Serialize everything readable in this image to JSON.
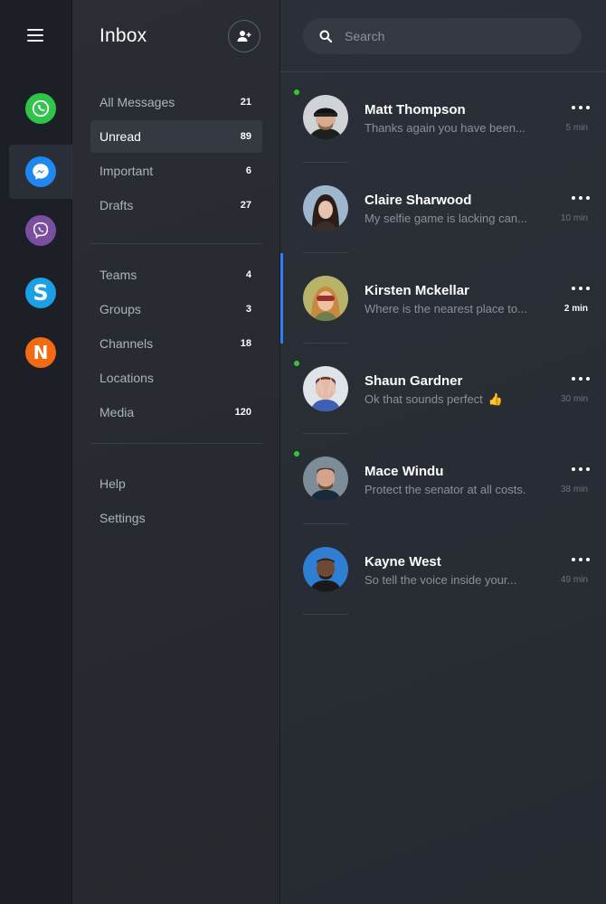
{
  "rail": {
    "apps": [
      {
        "name": "whatsapp-icon",
        "color": "#2fc548"
      },
      {
        "name": "messenger-icon",
        "color": "#1e87f0",
        "active": true
      },
      {
        "name": "viber-icon",
        "color": "#7b4fa0"
      },
      {
        "name": "skype-icon",
        "color": "#1ba0e6"
      },
      {
        "name": "n-app-icon",
        "color": "#f26a11",
        "glyph": "N"
      }
    ]
  },
  "folders": {
    "title": "Inbox",
    "primary": [
      {
        "label": "All Messages",
        "count": "21"
      },
      {
        "label": "Unread",
        "count": "89",
        "selected": true
      },
      {
        "label": "Important",
        "count": "6"
      },
      {
        "label": "Drafts",
        "count": "27"
      }
    ],
    "secondary": [
      {
        "label": "Teams",
        "count": "4"
      },
      {
        "label": "Groups",
        "count": "3"
      },
      {
        "label": "Channels",
        "count": "18"
      },
      {
        "label": "Locations",
        "count": ""
      },
      {
        "label": "Media",
        "count": "120"
      }
    ],
    "footer": [
      {
        "label": "Help"
      },
      {
        "label": "Settings"
      }
    ]
  },
  "search": {
    "placeholder": "Search"
  },
  "conversations": [
    {
      "name": "Matt Thompson",
      "preview": "Thanks again you have been...",
      "time": "5 min",
      "online": true,
      "active": false
    },
    {
      "name": "Claire Sharwood",
      "preview": "My selfie game is lacking can...",
      "time": "10 min",
      "online": false,
      "active": false
    },
    {
      "name": "Kirsten Mckellar",
      "preview": "Where is the nearest place to...",
      "time": "2 min",
      "online": false,
      "active": true
    },
    {
      "name": "Shaun Gardner",
      "preview": "Ok that sounds perfect",
      "time": "30 min",
      "online": true,
      "active": false,
      "emoji": "👍"
    },
    {
      "name": "Mace Windu",
      "preview": "Protect the senator at all costs.",
      "time": "38 min",
      "online": true,
      "active": false
    },
    {
      "name": "Kayne West",
      "preview": "So tell the voice inside your...",
      "time": "49 min",
      "online": false,
      "active": false
    }
  ],
  "colors": {
    "accent": "#2f7df6",
    "online": "#39c634"
  }
}
